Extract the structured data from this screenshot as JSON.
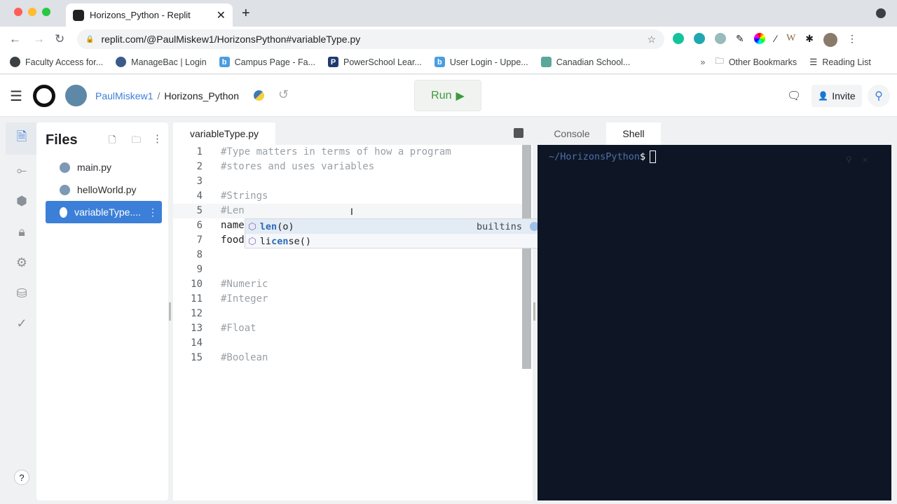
{
  "browser": {
    "tab_title": "Horizons_Python - Replit",
    "url": "replit.com/@PaulMiskew1/HorizonsPython#variableType.py",
    "bookmarks": [
      "Faculty Access for...",
      "ManageBac | Login",
      "Campus Page - Fa...",
      "PowerSchool Lear...",
      "User Login - Uppe...",
      "Canadian School..."
    ],
    "other_bookmarks": "Other Bookmarks",
    "reading_list": "Reading List",
    "overflow": "»"
  },
  "header": {
    "user": "PaulMiskew1",
    "separator": "/",
    "repl": "Horizons_Python",
    "run_label": "Run",
    "invite_label": "Invite"
  },
  "files": {
    "title": "Files",
    "items": [
      {
        "name": "main.py",
        "selected": false
      },
      {
        "name": "helloWorld.py",
        "selected": false
      },
      {
        "name": "variableType....",
        "selected": true
      }
    ]
  },
  "editor": {
    "tab": "variableType.py",
    "lines": [
      "#Type matters in terms of how a program",
      "#stores and uses variables",
      "",
      "#Strings",
      "#Len",
      "name",
      "food",
      "",
      "",
      "#Numeric",
      "#Integer",
      "",
      "#Float",
      "",
      "#Boolean"
    ],
    "autocomplete": [
      {
        "match": "len",
        "rest": "(o)",
        "source": "builtins"
      },
      {
        "pre": "li",
        "match": "cen",
        "rest": "se()",
        "source": ""
      }
    ]
  },
  "right": {
    "tabs": [
      "Console",
      "Shell"
    ],
    "active": "Shell",
    "prompt": "~/HorizonsPython",
    "dollar": "$"
  },
  "help": "?",
  "colors": {
    "accent": "#3c7fd8",
    "run": "#3a9b3a",
    "terminal_bg": "#0e1525"
  }
}
